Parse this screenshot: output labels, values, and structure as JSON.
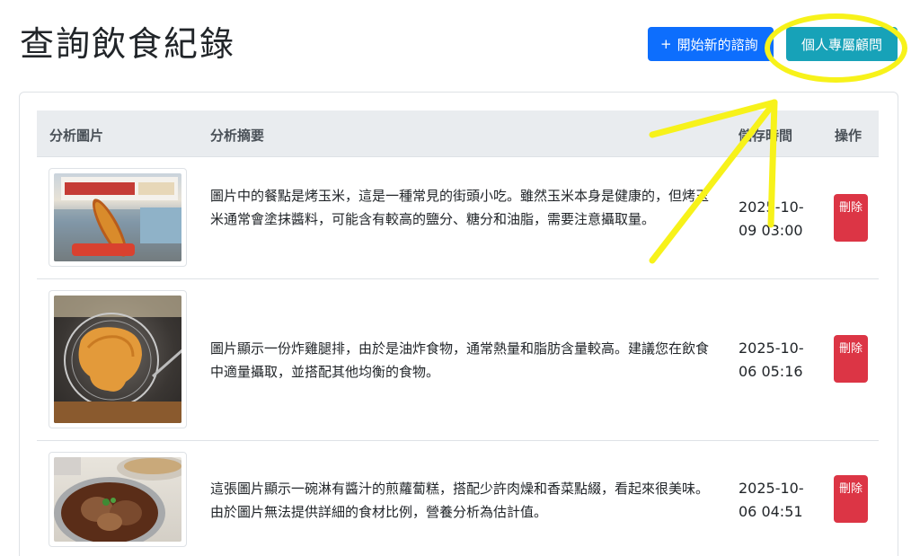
{
  "page": {
    "title": "查詢飲食紀錄"
  },
  "header_actions": {
    "new_consult_icon": "plus-icon",
    "new_consult_label": "開始新的諮詢",
    "advisor_label": "個人專屬顧問"
  },
  "table": {
    "columns": [
      "分析圖片",
      "分析摘要",
      "儲存時間",
      "操作"
    ],
    "rows": [
      {
        "image": "grilled-corn-photo",
        "summary": "圖片中的餐點是烤玉米，這是一種常見的街頭小吃。雖然玉米本身是健康的，但烤玉米通常會塗抹醬料，可能含有較高的鹽分、糖分和油脂，需要注意攝取量。",
        "datetime": "2025-10-09 03:00",
        "delete_label": "刪除"
      },
      {
        "image": "fried-chicken-cutlet-photo",
        "summary": "圖片顯示一份炸雞腿排，由於是油炸食物，通常熱量和脂肪含量較高。建議您在飲食中適量攝取，並搭配其他均衡的食物。",
        "datetime": "2025-10-06 05:16",
        "delete_label": "刪除"
      },
      {
        "image": "radish-cake-bowl-photo",
        "summary": "這張圖片顯示一碗淋有醬汁的煎蘿蔔糕，搭配少許肉燥和香菜點綴，看起來很美味。由於圖片無法提供詳細的食材比例，營養分析為估計值。",
        "datetime": "2025-10-06 04:51",
        "delete_label": "刪除"
      }
    ]
  },
  "colors": {
    "primary": "#0d6efd",
    "info": "#17a2b8",
    "danger": "#dc3545",
    "annotation": "#f7f21a",
    "header_bg": "#e9ecef"
  }
}
